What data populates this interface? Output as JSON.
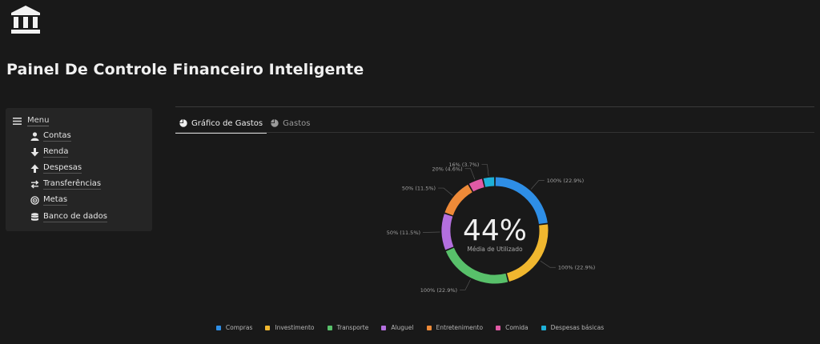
{
  "header": {
    "title": "Painel De Controle Financeiro Inteligente"
  },
  "sidebar": {
    "menu_label": "Menu",
    "items": [
      {
        "label": "Contas",
        "icon": "user-icon"
      },
      {
        "label": "Renda",
        "icon": "arrow-down-icon"
      },
      {
        "label": "Despesas",
        "icon": "arrow-up-icon"
      },
      {
        "label": "Transferências",
        "icon": "transfer-icon"
      },
      {
        "label": "Metas",
        "icon": "target-icon"
      },
      {
        "label": "Banco de dados",
        "icon": "database-icon"
      }
    ]
  },
  "tabs": [
    {
      "label": "Gráfico de Gastos",
      "icon": "pie-chart-icon",
      "active": true
    },
    {
      "label": "Gastos",
      "icon": "pie-chart-icon",
      "active": false
    }
  ],
  "chart_data": {
    "type": "pie",
    "variant": "donut",
    "center_value": "44%",
    "center_label": "Média de Utilizado",
    "legend_position": "bottom",
    "categories": [
      "Compras",
      "Investimento",
      "Transporte",
      "Aluguel",
      "Entretenimento",
      "Comida",
      "Despesas básicas"
    ],
    "values": [
      100,
      100,
      100,
      50,
      50,
      20,
      16
    ],
    "percentages": [
      22.9,
      22.9,
      22.9,
      11.5,
      11.5,
      4.6,
      3.7
    ],
    "data_labels": [
      "100% (22.9%)",
      "100% (22.9%)",
      "100% (22.9%)",
      "50% (11.5%)",
      "50% (11.5%)",
      "20% (4.6%)",
      "16% (3.7%)"
    ],
    "colors": [
      "#2e8ee6",
      "#f0b72f",
      "#58c06a",
      "#b36fde",
      "#ee8a38",
      "#e05aa5",
      "#1eb0d8"
    ]
  }
}
